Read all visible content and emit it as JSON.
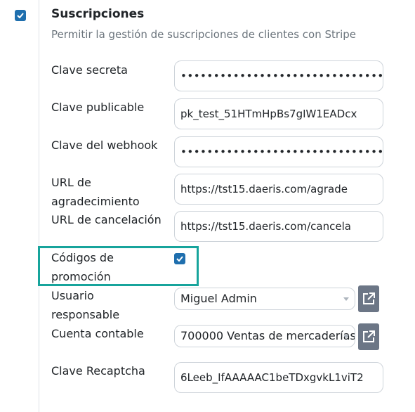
{
  "section": {
    "title": "Suscripciones",
    "subtitle": "Permitir la gestión de suscripciones de clientes con Stripe",
    "enabled": true
  },
  "fields": {
    "secret_key": {
      "label": "Clave secreta",
      "value": "•••••••••••••••••••••••••••••••••••••"
    },
    "publishable_key": {
      "label": "Clave publicable",
      "value": "pk_test_51HTmHpBs7gIW1EADcx"
    },
    "webhook_key": {
      "label": "Clave del webhook",
      "value": "••••••••••••••••••••••••••••••••••••"
    },
    "thanks_url": {
      "label": "URL de agradecimiento",
      "value": "https://tst15.daeris.com/agrade"
    },
    "cancel_url": {
      "label": "URL de cancelación",
      "value": "https://tst15.daeris.com/cancela"
    },
    "promo_codes": {
      "label": "Códigos de promoción",
      "checked": true
    },
    "responsible_user": {
      "label": "Usuario responsable",
      "value": "Miguel Admin"
    },
    "accounting_account": {
      "label": "Cuenta contable",
      "value": "700000 Ventas de mercaderías"
    },
    "recaptcha_key": {
      "label": "Clave Recaptcha",
      "value": "6Leeb_IfAAAAAC1beTDxgvkL1viT2"
    }
  },
  "icons": {
    "checkbox": "check-icon",
    "external": "external-link-icon",
    "dropdown": "caret-down-icon"
  },
  "colors": {
    "checkbox_bg": "#1f6fae",
    "highlight_border": "#17a49c",
    "external_button_bg": "#6c7686"
  }
}
